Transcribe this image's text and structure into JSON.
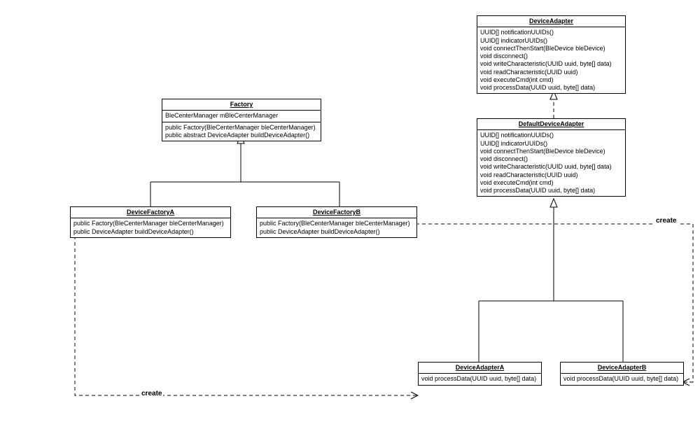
{
  "classes": {
    "Factory": {
      "title": "Factory",
      "attrs": [
        "BleCenterManager mBleCenterManager"
      ],
      "ops": [
        "public Factory(BleCenterManager bleCenterManager)",
        "public abstract DeviceAdapter buildDeviceAdapter()"
      ]
    },
    "DeviceFactoryA": {
      "title": "DeviceFactoryA",
      "ops": [
        "public Factory(BleCenterManager bleCenterManager)",
        "public DeviceAdapter buildDeviceAdapter()"
      ]
    },
    "DeviceFactoryB": {
      "title": "DeviceFactoryB",
      "ops": [
        "public Factory(BleCenterManager bleCenterManager)",
        "public DeviceAdapter buildDeviceAdapter()"
      ]
    },
    "DeviceAdapter": {
      "title": "DeviceAdapter",
      "ops": [
        "UUID[] notificationUUIDs()",
        "UUID[] indicatorUUIDs()",
        "void connectThenStart(BleDevice bleDevice)",
        "void disconnect()",
        "void writeCharacteristic(UUID uuid, byte[] data)",
        "void readCharacteristic(UUID uuid)",
        "void executeCmd(int cmd)",
        "void processData(UUID uuid, byte[] data)"
      ]
    },
    "DefaultDeviceAdapter": {
      "title": "DefaultDeviceAdapter",
      "ops": [
        "UUID[] notificationUUIDs()",
        "UUID[] indicatorUUIDs()",
        "void connectThenStart(BleDevice bleDevice)",
        "void disconnect()",
        "void writeCharacteristic(UUID uuid, byte[] data)",
        "void readCharacteristic(UUID uuid)",
        "void executeCmd(int cmd)",
        "void processData(UUID uuid, byte[] data)"
      ]
    },
    "DeviceAdapterA": {
      "title": "DeviceAdapterA",
      "ops": [
        "void processData(UUID uuid, byte[] data)"
      ]
    },
    "DeviceAdapterB": {
      "title": "DeviceAdapterB",
      "ops": [
        "void processData(UUID uuid, byte[] data)"
      ]
    }
  },
  "labels": {
    "createA": "create",
    "createB": "create"
  }
}
